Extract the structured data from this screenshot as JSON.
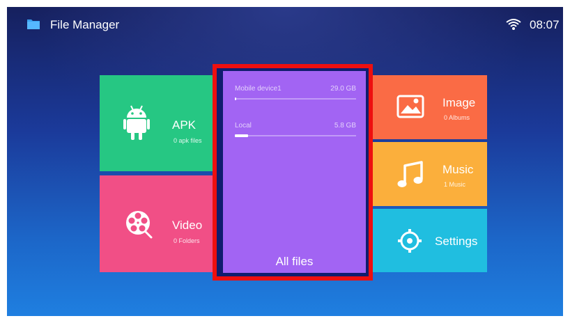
{
  "statusbar": {
    "app_title": "File Manager",
    "time": "08:07",
    "app_icon": "folder-icon",
    "wifi_icon": "wifi-icon"
  },
  "tiles": {
    "apk": {
      "title": "APK",
      "subtitle": "0 apk files",
      "icon": "android-icon",
      "color": "#26c783"
    },
    "video": {
      "title": "Video",
      "subtitle": "0 Folders",
      "icon": "film-reel-icon",
      "color": "#f14f86"
    },
    "image": {
      "title": "Image",
      "subtitle": "0 Albums",
      "icon": "picture-icon",
      "color": "#fa6b45"
    },
    "music": {
      "title": "Music",
      "subtitle": "1 Music",
      "icon": "music-note-icon",
      "color": "#fbaf3c"
    },
    "settings": {
      "title": "Settings",
      "icon": "gear-icon",
      "color": "#20bee0"
    }
  },
  "all_files": {
    "label": "All files",
    "color": "#a264f3",
    "highlight_color": "#ee0f0f",
    "storages": [
      {
        "name": "Mobile device1",
        "size": "29.0 GB",
        "used_fraction": 0.01
      },
      {
        "name": "Local",
        "size": "5.8 GB",
        "used_fraction": 0.11
      }
    ]
  }
}
